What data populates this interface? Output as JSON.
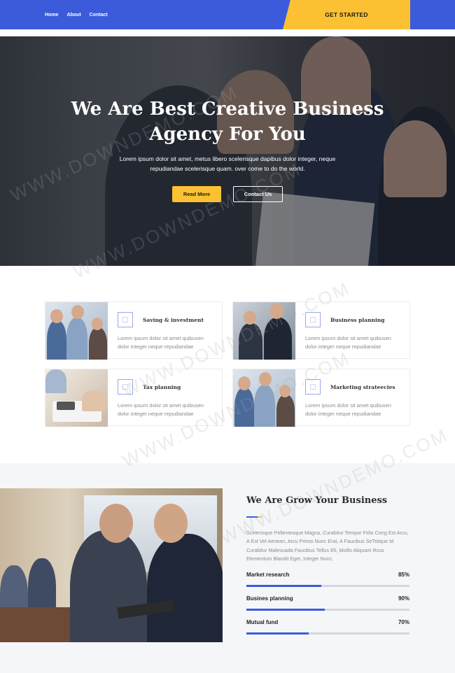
{
  "nav": {
    "items": [
      "Home",
      "About",
      "Contact"
    ],
    "cta_label": "GET STARTED"
  },
  "hero": {
    "title_line1": "We Are Best Creative Business",
    "title_line2": "Agency For You",
    "subtitle_line1": "Lorem ipsum dolor sit amet, metus libero scelerisque dapibus dolor integer, neque",
    "subtitle_line2": "repudiandae scelerisque quam. over come to do the world.",
    "read_more": "Read More",
    "contact_us": "Contact Us"
  },
  "services": [
    {
      "title": "Saving & investment",
      "text": "Lorem ipsum dolor sit amet quibusen dolor integer neque repudiandae"
    },
    {
      "title": "Business planning",
      "text": "Lorem ipsum dolor sit amet quibusen dolor integer neque repudiandae"
    },
    {
      "title": "Tax planning",
      "text": "Lorem ipsum dolor sit amet quibusen dolor integer neque repudiandae"
    },
    {
      "title": "Marketing strateecies",
      "text": "Lorem ipsum dolor sit amet quibusen dolor integer neque repudiandae"
    }
  ],
  "grow": {
    "title": "We Are Grow Your Business",
    "text": "Scelerisque Pellentesque Magna, Curabitur Tempor Felis Cong Est Arcu, A Est Vel Aenean, Arcu Primis Nunc Erat, A Faucibus SeTstique Id Curabitur Malesuada Faucibus Tellus Elt, Mollis Aliquam Rcus Elementum Blandit Eget, Integer Nunc.",
    "skills": [
      {
        "label": "Market research",
        "value": "85%",
        "fraction": 0.46
      },
      {
        "label": "Busines planning",
        "value": "90%",
        "fraction": 0.48
      },
      {
        "label": "Mutual fund",
        "value": "70%",
        "fraction": 0.38
      }
    ]
  },
  "watermark": "WWW.DOWNDEMO.COM",
  "colors": {
    "primary": "#3b5bdb",
    "accent": "#fcc133"
  }
}
